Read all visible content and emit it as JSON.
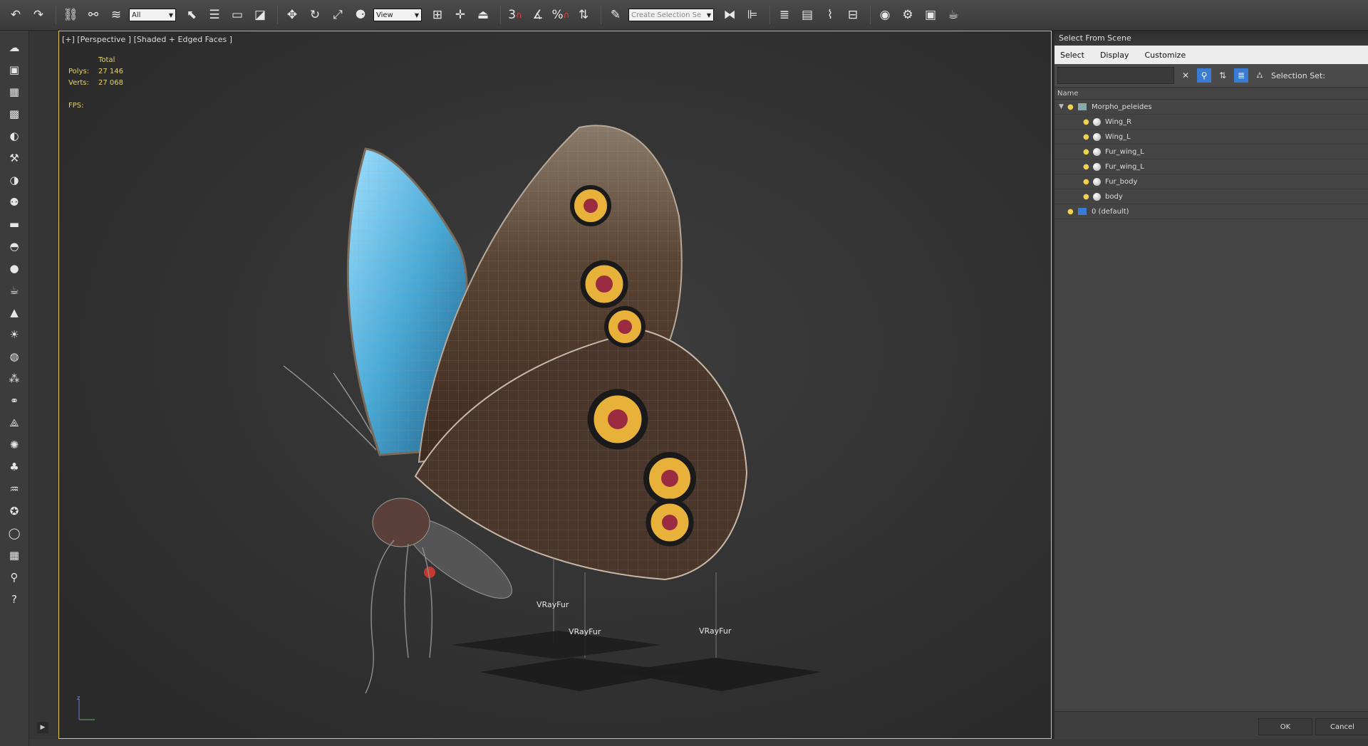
{
  "toolbar": {
    "selection_filter": "All",
    "ref_coord": "View",
    "snap_label": "3",
    "percent_label": "%",
    "selection_set_placeholder": "Create Selection Se"
  },
  "viewport": {
    "label": "[+] [Perspective ] [Shaded + Edged Faces ]",
    "stats": {
      "header": "Total",
      "polys_label": "Polys:",
      "polys_value": "27 146",
      "verts_label": "Verts:",
      "verts_value": "27 068",
      "fps_label": "FPS:"
    },
    "gizmos": [
      {
        "label": "VRayFur"
      },
      {
        "label": "VRayFur"
      },
      {
        "label": "VRayFur"
      }
    ]
  },
  "panel": {
    "title": "Select From Scene",
    "menu": [
      "Select",
      "Display",
      "Customize"
    ],
    "selection_set_label": "Selection Set:",
    "column_name": "Name",
    "tree": [
      {
        "label": "Morpho_peleides",
        "level": 0
      },
      {
        "label": "Wing_R",
        "level": 1
      },
      {
        "label": "Wing_L",
        "level": 1
      },
      {
        "label": "Fur_wing_L",
        "level": 1
      },
      {
        "label": "Fur_wing_L",
        "level": 1
      },
      {
        "label": "Fur_body",
        "level": 1
      },
      {
        "label": "body",
        "level": 1
      },
      {
        "label": "0 (default)",
        "level": 0
      }
    ],
    "ok_label": "OK",
    "cancel_label": "Cancel"
  },
  "colors": {
    "viewport_border": "#e2c64a",
    "stats_text": "#e8d36a",
    "accent": "#3a7bd5"
  }
}
